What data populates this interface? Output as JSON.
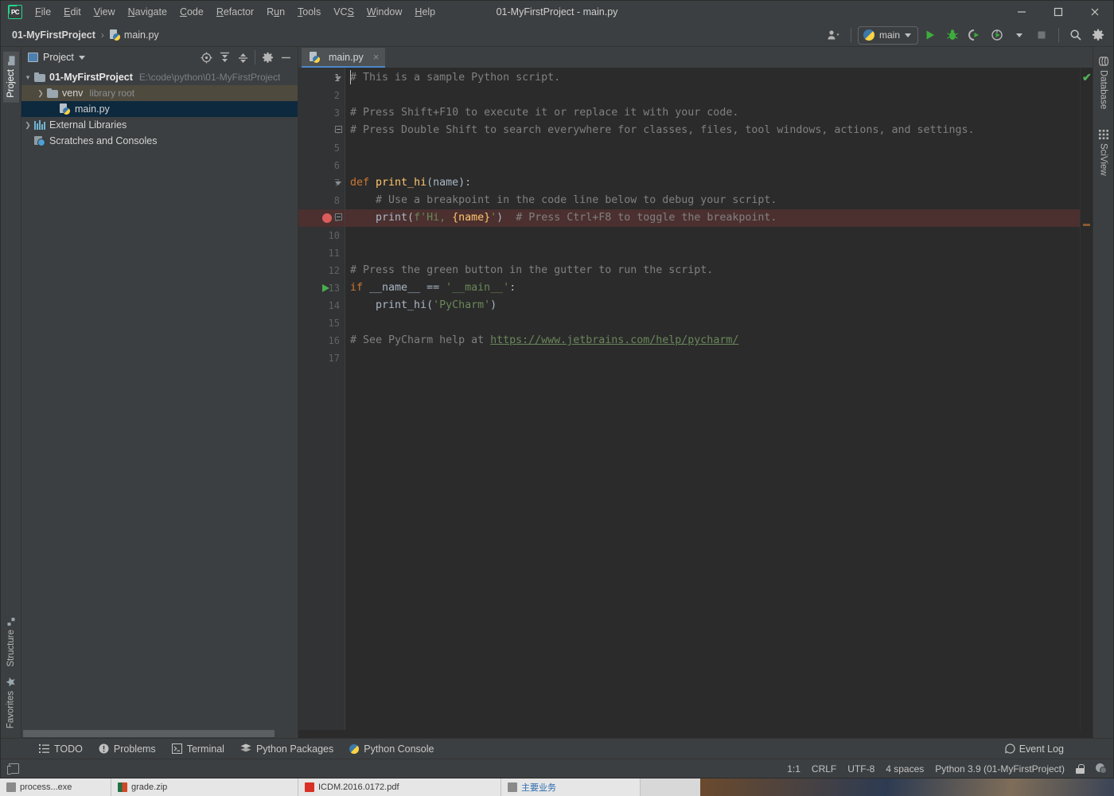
{
  "window": {
    "title": "01-MyFirstProject - main.py",
    "app_icon": "pycharm-logo-icon",
    "controls": {
      "minimize": "minimize-icon",
      "maximize": "maximize-icon",
      "close": "close-icon"
    }
  },
  "menubar": {
    "items": [
      {
        "label": "File",
        "mnemonic": "F"
      },
      {
        "label": "Edit",
        "mnemonic": "E"
      },
      {
        "label": "View",
        "mnemonic": "V"
      },
      {
        "label": "Navigate",
        "mnemonic": "N"
      },
      {
        "label": "Code",
        "mnemonic": "C"
      },
      {
        "label": "Refactor",
        "mnemonic": "R"
      },
      {
        "label": "Run",
        "mnemonic": "u"
      },
      {
        "label": "Tools",
        "mnemonic": "T"
      },
      {
        "label": "VCS",
        "mnemonic": "S"
      },
      {
        "label": "Window",
        "mnemonic": "W"
      },
      {
        "label": "Help",
        "mnemonic": "H"
      }
    ]
  },
  "navbar": {
    "breadcrumbs": [
      {
        "label": "01-MyFirstProject",
        "icon": ""
      },
      {
        "label": "main.py",
        "icon": "python-file-icon"
      }
    ],
    "separator": "›",
    "run_config": {
      "label": "main",
      "icon": "python-icon"
    },
    "buttons": [
      {
        "name": "user-account-button",
        "icon": "user-icon"
      },
      {
        "name": "run-button",
        "icon": "run-icon"
      },
      {
        "name": "debug-button",
        "icon": "debug-icon"
      },
      {
        "name": "run-coverage-button",
        "icon": "coverage-icon"
      },
      {
        "name": "profile-button",
        "icon": "profiler-icon"
      },
      {
        "name": "stop-button",
        "icon": "stop-icon"
      },
      {
        "name": "search-everywhere-button",
        "icon": "search-icon"
      },
      {
        "name": "settings-button",
        "icon": "gear-icon"
      }
    ]
  },
  "left_strip": {
    "top": [
      {
        "label": "Project",
        "icon": "project-icon",
        "active": true
      }
    ],
    "bottom": [
      {
        "label": "Structure",
        "icon": "structure-icon"
      },
      {
        "label": "Favorites",
        "icon": "star-icon"
      }
    ]
  },
  "right_strip": {
    "items": [
      {
        "label": "Database",
        "icon": "database-icon"
      },
      {
        "label": "SciView",
        "icon": "sciview-icon"
      }
    ]
  },
  "project_panel": {
    "title": "Project",
    "title_caret": "▾",
    "actions": [
      {
        "name": "select-opened-file-button",
        "icon": "crosshair-icon"
      },
      {
        "name": "expand-all-button",
        "icon": "expand-all-icon"
      },
      {
        "name": "collapse-all-button",
        "icon": "collapse-all-icon"
      },
      {
        "name": "panel-settings-button",
        "icon": "gear-icon"
      },
      {
        "name": "hide-panel-button",
        "icon": "minimize-icon"
      }
    ],
    "tree": [
      {
        "label": "01-MyFirstProject",
        "secondary": "E:\\code\\python\\01-MyFirstProject",
        "arrow": "⌄",
        "icon": "folder-icon",
        "depth": 0,
        "bold": true,
        "state": "normal"
      },
      {
        "label": "venv",
        "secondary": "library root",
        "arrow": "›",
        "icon": "folder-icon",
        "depth": 1,
        "bold": false,
        "state": "highlighted"
      },
      {
        "label": "main.py",
        "secondary": "",
        "arrow": "",
        "icon": "python-file-icon",
        "depth": 2,
        "bold": false,
        "state": "selected"
      },
      {
        "label": "External Libraries",
        "secondary": "",
        "arrow": "›",
        "icon": "library-icon",
        "depth": 0,
        "bold": false,
        "state": "normal"
      },
      {
        "label": "Scratches and Consoles",
        "secondary": "",
        "arrow": "",
        "icon": "scratches-icon",
        "depth": 0,
        "bold": false,
        "state": "normal"
      }
    ]
  },
  "editor": {
    "tabs": [
      {
        "label": "main.py",
        "icon": "python-file-icon",
        "active": true,
        "close": "×"
      }
    ],
    "status_check": "✔",
    "lines": [
      {
        "n": 1,
        "tokens": [
          {
            "t": "# This is a sample Python script.",
            "c": "cm"
          }
        ]
      },
      {
        "n": 2,
        "tokens": []
      },
      {
        "n": 3,
        "tokens": [
          {
            "t": "# Press Shift+F10 to execute it or replace it with your code.",
            "c": "cm"
          }
        ]
      },
      {
        "n": 4,
        "tokens": [
          {
            "t": "# Press Double Shift to search everywhere for classes, files, tool windows, actions, and settings.",
            "c": "cm"
          }
        ]
      },
      {
        "n": 5,
        "tokens": []
      },
      {
        "n": 6,
        "tokens": []
      },
      {
        "n": 7,
        "tokens": [
          {
            "t": "def ",
            "c": "kw"
          },
          {
            "t": "print_hi",
            "c": "fn"
          },
          {
            "t": "(name):",
            "c": "idn"
          }
        ]
      },
      {
        "n": 8,
        "tokens": [
          {
            "t": "    # Use a breakpoint in the code line below to debug your script.",
            "c": "cm"
          }
        ]
      },
      {
        "n": 9,
        "tokens": [
          {
            "t": "    print(",
            "c": "idn"
          },
          {
            "t": "f'Hi, ",
            "c": "str"
          },
          {
            "t": "{name}",
            "c": "fn"
          },
          {
            "t": "'",
            "c": "str"
          },
          {
            "t": ")",
            "c": "idn"
          },
          {
            "t": "  # Press Ctrl+F8 to toggle the breakpoint.",
            "c": "cm"
          }
        ],
        "breakpoint": true
      },
      {
        "n": 10,
        "tokens": []
      },
      {
        "n": 11,
        "tokens": []
      },
      {
        "n": 12,
        "tokens": [
          {
            "t": "# Press the green button in the gutter to run the script.",
            "c": "cm"
          }
        ]
      },
      {
        "n": 13,
        "tokens": [
          {
            "t": "if ",
            "c": "kw"
          },
          {
            "t": "__name__ ",
            "c": "idn"
          },
          {
            "t": "== ",
            "c": "idn"
          },
          {
            "t": "'__main__'",
            "c": "str"
          },
          {
            "t": ":",
            "c": "idn"
          }
        ],
        "runmarker": true
      },
      {
        "n": 14,
        "tokens": [
          {
            "t": "    print_hi(",
            "c": "idn"
          },
          {
            "t": "'PyCharm'",
            "c": "str"
          },
          {
            "t": ")",
            "c": "idn"
          }
        ]
      },
      {
        "n": 15,
        "tokens": []
      },
      {
        "n": 16,
        "tokens": [
          {
            "t": "# See PyCharm help at ",
            "c": "cm"
          },
          {
            "t": "https://www.jetbrains.com/help/pycharm/",
            "c": "link"
          }
        ]
      },
      {
        "n": 17,
        "tokens": []
      }
    ]
  },
  "bottom_bar": {
    "tabs": [
      {
        "label": "TODO",
        "icon": "todo-icon"
      },
      {
        "label": "Problems",
        "icon": "problems-icon"
      },
      {
        "label": "Terminal",
        "icon": "terminal-icon"
      },
      {
        "label": "Python Packages",
        "icon": "packages-icon"
      },
      {
        "label": "Python Console",
        "icon": "python-console-icon"
      }
    ],
    "event_log": {
      "label": "Event Log",
      "icon": "event-log-icon"
    }
  },
  "status_bar": {
    "left_icon": "hide-tool-windows-icon",
    "items": [
      {
        "name": "caret-position",
        "label": "1:1"
      },
      {
        "name": "line-separator",
        "label": "CRLF"
      },
      {
        "name": "file-encoding",
        "label": "UTF-8"
      },
      {
        "name": "indent-size",
        "label": "4 spaces"
      },
      {
        "name": "python-interpreter",
        "label": "Python 3.9 (01-MyFirstProject)"
      }
    ],
    "lock_icon": "lock-icon",
    "inspection_icon": "inspections-icon"
  },
  "taskbar": {
    "items": [
      {
        "label": "process...exe",
        "icon": "gen"
      },
      {
        "label": "grade.zip",
        "icon": "excel"
      },
      {
        "label": "ICDM.2016.0172.pdf",
        "icon": "pdf"
      },
      {
        "label": "主要业务",
        "icon": "gen",
        "cn": true
      }
    ]
  },
  "colors": {
    "accent": "#4a88c7",
    "background": "#3c3f41",
    "editor_background": "#2b2b2b",
    "breakpoint": "#db5c5c",
    "run_green": "#49ad4c",
    "selection": "#0d293e",
    "highlight_row": "#4e4a3e",
    "comment": "#808080",
    "keyword": "#cc7832",
    "string": "#6a8759",
    "function": "#ffc66d"
  }
}
